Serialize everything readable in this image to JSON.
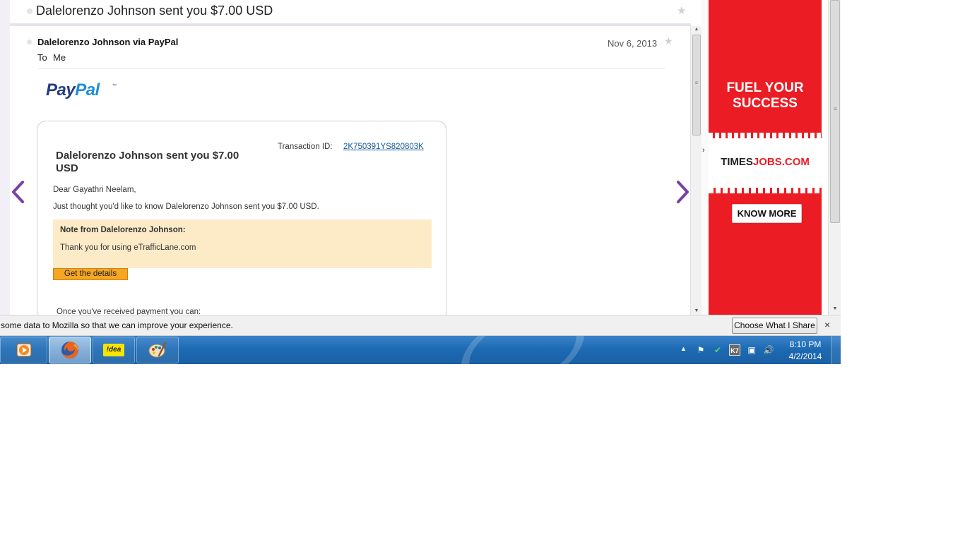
{
  "subject": {
    "text": "Dalelorenzo Johnson sent you $7.00 USD"
  },
  "message": {
    "sender": "Dalelorenzo Johnson via PayPal",
    "to_label": "To",
    "to_value": "Me",
    "date": "Nov 6, 2013"
  },
  "email": {
    "logo_pay": "Pay",
    "logo_pal": "Pal",
    "logo_tm": "™",
    "title": "Dalelorenzo Johnson sent you $7.00 USD",
    "transaction_label": "Transaction ID:",
    "transaction_id": "2K750391YS820803K",
    "greeting": "Dear Gayathri Neelam,",
    "body": "Just thought you'd like to know Dalelorenzo Johnson sent you $7.00 USD.",
    "note_title": "Note from Dalelorenzo Johnson:",
    "note_text": "Thank you for using eTrafficLane.com",
    "details_button": "Get the details",
    "partial_line": "Once you've received payment you can:"
  },
  "ad": {
    "headline_line1": "FUEL YOUR",
    "headline_line2": "SUCCESS",
    "brand_times": "TIMES",
    "brand_jobs": "JOBS.COM",
    "cta": "KNOW MORE",
    "background_color": "#ec1c24"
  },
  "notification": {
    "text": "some data to Mozilla so that we can improve your experience.",
    "button": "Choose What I Share",
    "close": "×"
  },
  "taskbar": {
    "apps": [
      "media-player-icon",
      "firefox-icon",
      "idea-icon",
      "paint-icon"
    ],
    "idea_label": "!dea",
    "time": "8:10 PM",
    "date": "4/2/2014"
  },
  "colors": {
    "accent_purple": "#7b3fa0",
    "link_blue": "#1a5aa0",
    "button_orange": "#f5a623",
    "note_background": "#fdebc8"
  }
}
